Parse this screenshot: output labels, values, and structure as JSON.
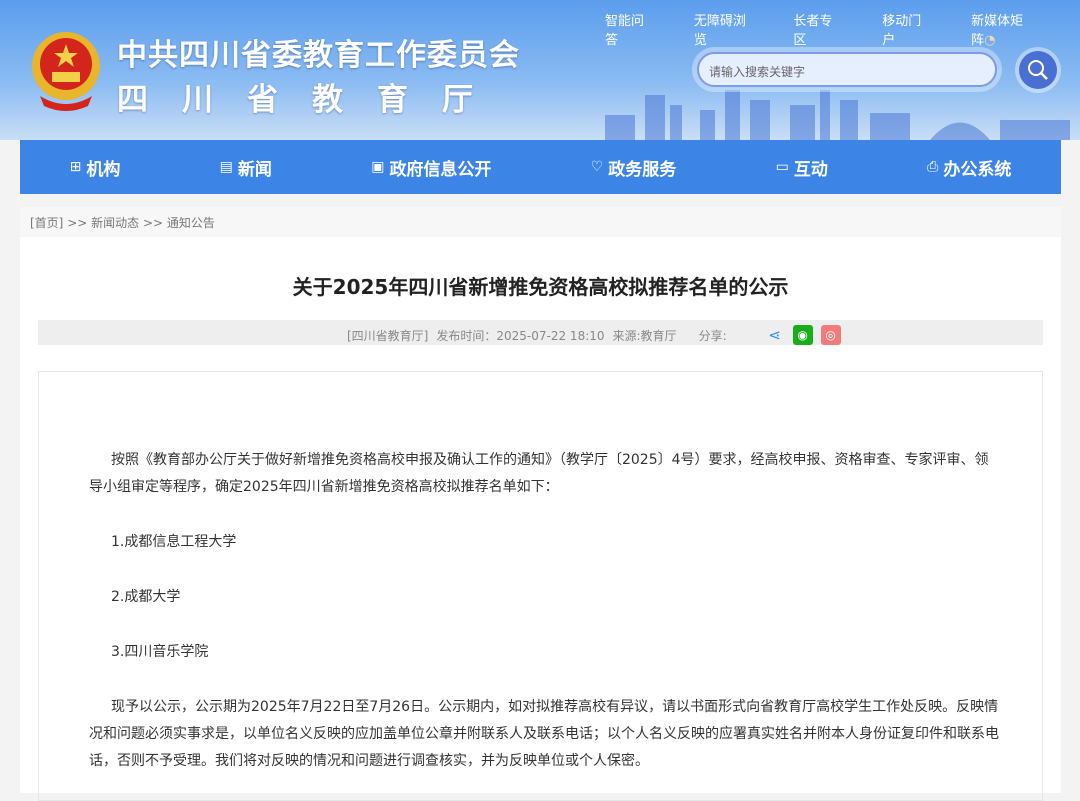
{
  "header": {
    "title_cn": "中共四川省委教育工作委员会",
    "title_sub": "四川省教育厅",
    "top_links": [
      "智能问答",
      "无障碍浏览",
      "长者专区",
      "移动门户",
      "新媒体矩阵"
    ],
    "search_placeholder": "请输入搜索关键字"
  },
  "nav": [
    {
      "label": "机构",
      "icon": "org-icon"
    },
    {
      "label": "新闻",
      "icon": "news-icon"
    },
    {
      "label": "政府信息公开",
      "icon": "info-icon"
    },
    {
      "label": "政务服务",
      "icon": "service-icon"
    },
    {
      "label": "互动",
      "icon": "chat-icon"
    },
    {
      "label": "办公系统",
      "icon": "printer-icon"
    }
  ],
  "breadcrumb": {
    "home": "[首页]",
    "sep": ">>",
    "l1": "新闻动态",
    "l2": "通知公告"
  },
  "article": {
    "title": "关于2025年四川省新增推免资格高校拟推荐名单的公示",
    "meta": {
      "source_tag": "[四川省教育厅]",
      "published": "发布时间：2025-07-22 18:10",
      "source": "来源:教育厅",
      "share": "分享:"
    },
    "paragraphs": [
      "按照《教育部办公厅关于做好新增推免资格高校申报及确认工作的通知》（教学厅〔2025〕4号）要求，经高校申报、资格审查、专家评审、领导小组审定等程序，确定2025年四川省新增推免资格高校拟推荐名单如下：",
      "1.成都信息工程大学",
      "2.成都大学",
      "3.四川音乐学院",
      "现予以公示，公示期为2025年7月22日至7月26日。公示期内，如对拟推荐高校有异议，请以书面形式向省教育厅高校学生工作处反映。反映情况和问题必须实事求是，以单位名义反映的应加盖单位公章并附联系人及联系电话；以个人名义反映的应署真实姓名并附本人身份证复印件和联系电话，否则不予受理。我们将对反映的情况和问题进行调查核实，并为反映单位或个人保密。"
    ]
  },
  "colors": {
    "nav": "#3c84e6",
    "wechat": "#1aad19",
    "weibo": "#f27b7b",
    "share": "#2a8ff0"
  }
}
